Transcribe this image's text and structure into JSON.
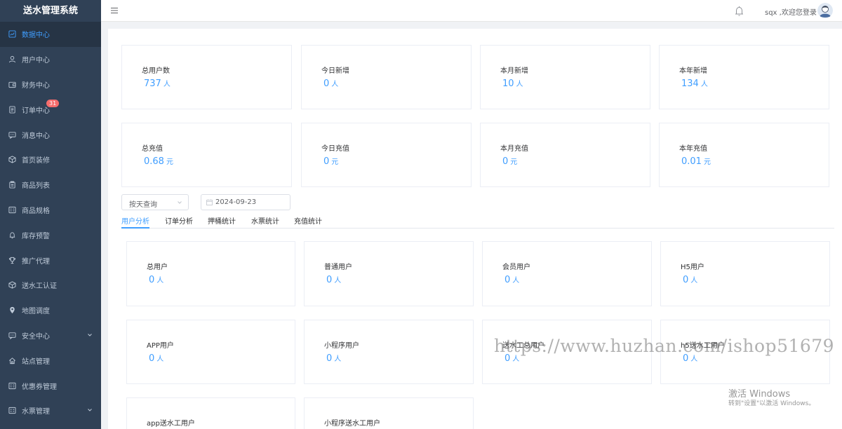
{
  "app": {
    "title": "送水管理系统"
  },
  "sidebar": {
    "items": [
      {
        "label": "数据中心",
        "icon": "dashboard-icon",
        "active": true
      },
      {
        "label": "用户中心",
        "icon": "user-icon"
      },
      {
        "label": "财务中心",
        "icon": "wallet-icon"
      },
      {
        "label": "订单中心",
        "icon": "document-icon",
        "badge": "31"
      },
      {
        "label": "消息中心",
        "icon": "chat-icon"
      },
      {
        "label": "首页装修",
        "icon": "box-icon"
      },
      {
        "label": "商品列表",
        "icon": "clipboard-icon"
      },
      {
        "label": "商品规格",
        "icon": "grid-icon"
      },
      {
        "label": "库存预警",
        "icon": "bell-icon"
      },
      {
        "label": "推广代理",
        "icon": "trophy-icon"
      },
      {
        "label": "送水工认证",
        "icon": "box-icon"
      },
      {
        "label": "地图调度",
        "icon": "location-icon"
      },
      {
        "label": "安全中心",
        "icon": "chat-icon",
        "expandable": true
      },
      {
        "label": "站点管理",
        "icon": "home-icon"
      },
      {
        "label": "优惠券管理",
        "icon": "grid-icon"
      },
      {
        "label": "水票管理",
        "icon": "grid-icon",
        "expandable": true
      }
    ]
  },
  "header": {
    "user_text": "sqx ,欢迎您登录"
  },
  "stats": {
    "users": [
      {
        "label": "总用户数",
        "value": "737",
        "unit": "人"
      },
      {
        "label": "今日新增",
        "value": "0",
        "unit": "人"
      },
      {
        "label": "本月新增",
        "value": "10",
        "unit": "人"
      },
      {
        "label": "本年新增",
        "value": "134",
        "unit": "人"
      }
    ],
    "recharge": [
      {
        "label": "总充值",
        "value": "0.68",
        "unit": "元"
      },
      {
        "label": "今日充值",
        "value": "0",
        "unit": "元"
      },
      {
        "label": "本月充值",
        "value": "0",
        "unit": "元"
      },
      {
        "label": "本年充值",
        "value": "0.01",
        "unit": "元"
      }
    ]
  },
  "filter": {
    "mode": "按天查询",
    "date": "2024-09-23"
  },
  "tabs": [
    {
      "label": "用户分析",
      "active": true
    },
    {
      "label": "订单分析"
    },
    {
      "label": "押桶统计"
    },
    {
      "label": "水票统计"
    },
    {
      "label": "充值统计"
    }
  ],
  "analysis": [
    {
      "label": "总用户",
      "value": "0",
      "unit": "人"
    },
    {
      "label": "普通用户",
      "value": "0",
      "unit": "人"
    },
    {
      "label": "会员用户",
      "value": "0",
      "unit": "人"
    },
    {
      "label": "H5用户",
      "value": "0",
      "unit": "人"
    },
    {
      "label": "APP用户",
      "value": "0",
      "unit": "人"
    },
    {
      "label": "小程序用户",
      "value": "0",
      "unit": "人"
    },
    {
      "label": "送水工总用户",
      "value": "0",
      "unit": "人"
    },
    {
      "label": "h5送水工用户",
      "value": "0",
      "unit": "人"
    },
    {
      "label": "app送水工用户",
      "value": "",
      "unit": ""
    },
    {
      "label": "小程序送水工用户",
      "value": "",
      "unit": ""
    }
  ],
  "overlay": {
    "watermark": "https://www.huzhan.com/ishop51679",
    "activate_title": "激活 Windows",
    "activate_sub": "转到\"设置\"以激活 Windows。"
  },
  "colors": {
    "accent": "#409eff",
    "sidebar_bg": "#304156",
    "badge": "#f56c6c"
  }
}
